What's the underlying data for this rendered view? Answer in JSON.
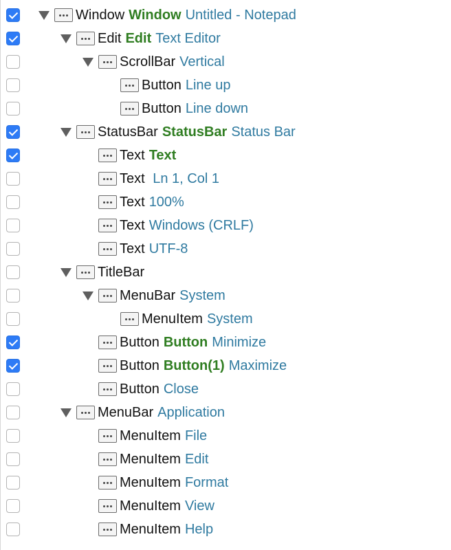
{
  "tree": {
    "rows": [
      {
        "checked": true,
        "level": 0,
        "expand": true,
        "type": "Window",
        "name": "Window",
        "desc": "Untitled - Notepad"
      },
      {
        "checked": true,
        "level": 1,
        "expand": true,
        "type": "Edit",
        "name": "Edit",
        "desc": "Text Editor"
      },
      {
        "checked": false,
        "level": 2,
        "expand": true,
        "type": "ScrollBar",
        "name": "",
        "desc": "Vertical"
      },
      {
        "checked": false,
        "level": 3,
        "expand": false,
        "type": "Button",
        "name": "",
        "desc": "Line up"
      },
      {
        "checked": false,
        "level": 3,
        "expand": false,
        "type": "Button",
        "name": "",
        "desc": "Line down"
      },
      {
        "checked": true,
        "level": 1,
        "expand": true,
        "type": "StatusBar",
        "name": "StatusBar",
        "desc": "Status Bar"
      },
      {
        "checked": true,
        "level": 2,
        "expand": false,
        "type": "Text",
        "name": "Text",
        "desc": ""
      },
      {
        "checked": false,
        "level": 2,
        "expand": false,
        "type": "Text",
        "name": "",
        "desc": " Ln 1, Col 1"
      },
      {
        "checked": false,
        "level": 2,
        "expand": false,
        "type": "Text",
        "name": "",
        "desc": "100%"
      },
      {
        "checked": false,
        "level": 2,
        "expand": false,
        "type": "Text",
        "name": "",
        "desc": "Windows (CRLF)"
      },
      {
        "checked": false,
        "level": 2,
        "expand": false,
        "type": "Text",
        "name": "",
        "desc": "UTF-8"
      },
      {
        "checked": false,
        "level": 1,
        "expand": true,
        "type": "TitleBar",
        "name": "",
        "desc": ""
      },
      {
        "checked": false,
        "level": 2,
        "expand": true,
        "type": "MenuBar",
        "name": "",
        "desc": "System"
      },
      {
        "checked": false,
        "level": 3,
        "expand": false,
        "type": "MenuItem",
        "name": "",
        "desc": "System"
      },
      {
        "checked": true,
        "level": 2,
        "expand": false,
        "type": "Button",
        "name": "Button",
        "desc": "Minimize"
      },
      {
        "checked": true,
        "level": 2,
        "expand": false,
        "type": "Button",
        "name": "Button(1)",
        "desc": "Maximize"
      },
      {
        "checked": false,
        "level": 2,
        "expand": false,
        "type": "Button",
        "name": "",
        "desc": "Close"
      },
      {
        "checked": false,
        "level": 1,
        "expand": true,
        "type": "MenuBar",
        "name": "",
        "desc": "Application"
      },
      {
        "checked": false,
        "level": 2,
        "expand": false,
        "type": "MenuItem",
        "name": "",
        "desc": "File"
      },
      {
        "checked": false,
        "level": 2,
        "expand": false,
        "type": "MenuItem",
        "name": "",
        "desc": "Edit"
      },
      {
        "checked": false,
        "level": 2,
        "expand": false,
        "type": "MenuItem",
        "name": "",
        "desc": "Format"
      },
      {
        "checked": false,
        "level": 2,
        "expand": false,
        "type": "MenuItem",
        "name": "",
        "desc": "View"
      },
      {
        "checked": false,
        "level": 2,
        "expand": false,
        "type": "MenuItem",
        "name": "",
        "desc": "Help"
      }
    ]
  },
  "icons": {
    "element": "element-dots-icon",
    "expand": "disclosure-triangle-icon",
    "checked": "checkmark-icon"
  },
  "colors": {
    "checkbox_checked": "#2d7bf6",
    "name_text": "#2f7d21",
    "description_text": "#2f7aa0",
    "type_text": "#111111"
  }
}
